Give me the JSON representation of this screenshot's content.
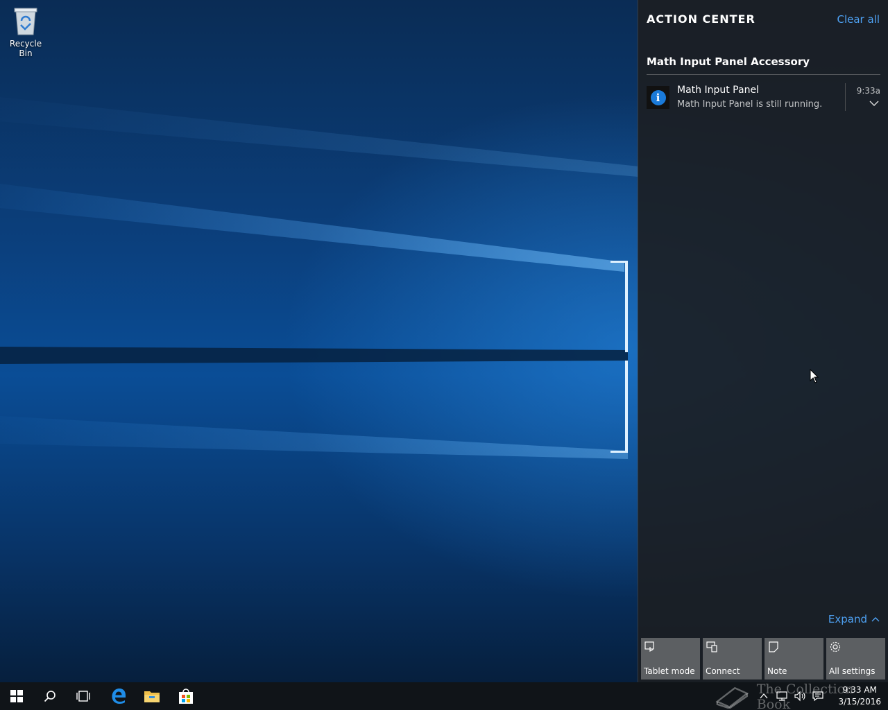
{
  "desktop": {
    "icons": [
      {
        "label": "Recycle Bin",
        "icon": "recycle-bin-icon"
      }
    ]
  },
  "action_center": {
    "title": "ACTION CENTER",
    "clear_all": "Clear all",
    "group_header": "Math Input Panel Accessory",
    "notification": {
      "icon": "info-icon",
      "icon_glyph": "i",
      "title": "Math Input Panel",
      "body": "Math Input Panel is still running.",
      "time": "9:33a"
    },
    "expand_label": "Expand",
    "quick_actions": [
      {
        "label": "Tablet mode",
        "icon": "tablet-mode-icon"
      },
      {
        "label": "Connect",
        "icon": "connect-icon"
      },
      {
        "label": "Note",
        "icon": "note-icon"
      },
      {
        "label": "All settings",
        "icon": "gear-icon"
      }
    ],
    "accent_color": "#4ea1f3"
  },
  "taskbar": {
    "pinned": [
      "start-icon",
      "search-icon",
      "task-view-icon",
      "edge-icon",
      "file-explorer-icon",
      "store-icon"
    ],
    "tray_icons": [
      "chevron-up-icon",
      "network-icon",
      "speaker-icon",
      "action-center-icon"
    ],
    "clock": {
      "time": "9:33 AM",
      "date": "3/15/2016"
    }
  },
  "watermark": {
    "text": "The Collection Book"
  }
}
